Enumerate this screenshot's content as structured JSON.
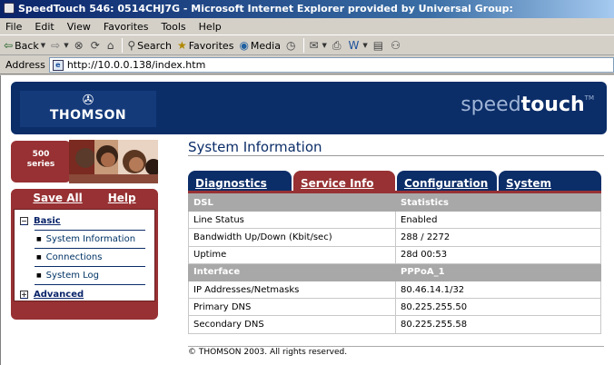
{
  "window": {
    "title": "SpeedTouch 546:  0514CHJ7G - Microsoft Internet Explorer provided by Universal Group:"
  },
  "menu": [
    "File",
    "Edit",
    "View",
    "Favorites",
    "Tools",
    "Help"
  ],
  "toolbar": {
    "back": "Back",
    "search": "Search",
    "favorites": "Favorites",
    "media": "Media"
  },
  "address": {
    "label": "Address",
    "url": "http://10.0.0.138/index.htm"
  },
  "banner": {
    "logo": "THOMSON",
    "brand_light": "speed",
    "brand_bold": "touch",
    "tm": "TM"
  },
  "series": {
    "line1": "500",
    "line2": "series"
  },
  "nav": {
    "save_all": "Save All",
    "help": "Help",
    "basic": "Basic",
    "items": [
      "System Information",
      "Connections",
      "System Log"
    ],
    "advanced": "Advanced"
  },
  "main": {
    "title": "System Information",
    "tabs": [
      "Diagnostics",
      "Service Info",
      "Configuration",
      "System"
    ],
    "rows": [
      {
        "label": "DSL",
        "value": "Statistics"
      },
      {
        "label": "Line Status",
        "value": "Enabled"
      },
      {
        "label": "Bandwidth Up/Down (Kbit/sec)",
        "value": "288 / 2272"
      },
      {
        "label": "Uptime",
        "value": "28d 00:53"
      },
      {
        "label": "Interface",
        "value": "PPPoA_1"
      },
      {
        "label": "IP Addresses/Netmasks",
        "value": "80.46.14.1/32"
      },
      {
        "label": "Primary DNS",
        "value": "80.225.255.50"
      },
      {
        "label": "Secondary DNS",
        "value": "80.225.255.58"
      }
    ],
    "footer": "© THOMSON 2003. All rights reserved."
  },
  "colors": {
    "navy": "#0b2d68",
    "maroon": "#973133",
    "header_gray": "#a8a8a8"
  }
}
